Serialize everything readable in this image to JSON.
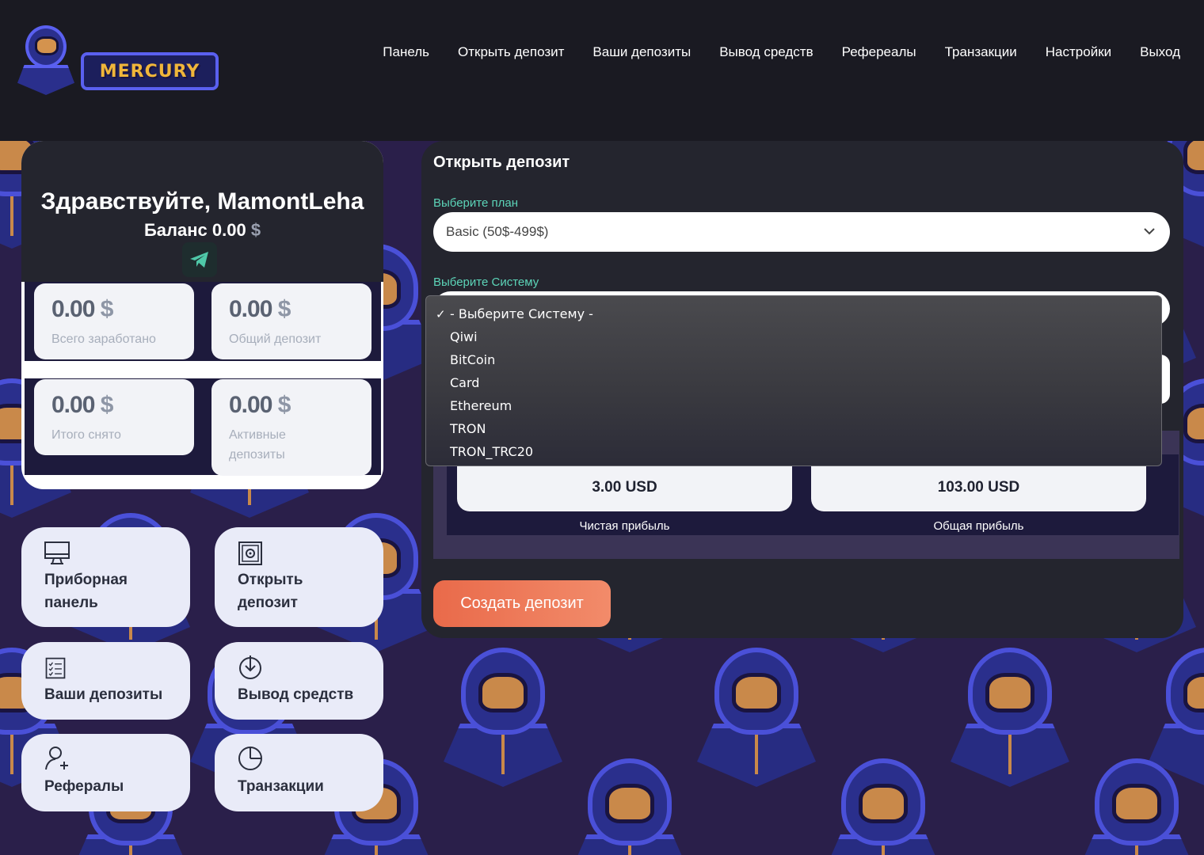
{
  "brand": {
    "name": "MERCURY"
  },
  "nav": [
    "Панель",
    "Открыть депозит",
    "Ваши депозиты",
    "Вывод средств",
    "Рефереалы",
    "Транзакции",
    "Настройки",
    "Выход"
  ],
  "user": {
    "greeting": "Здравствуйте, MamontLeha",
    "balance_label": "Баланс",
    "balance_value": "0.00",
    "currency_symbol": "$"
  },
  "stats": [
    {
      "value": "0.00",
      "symbol": "$",
      "label": "Всего заработано"
    },
    {
      "value": "0.00",
      "symbol": "$",
      "label": "Общий депозит"
    },
    {
      "value": "0.00",
      "symbol": "$",
      "label": "Итого снято"
    },
    {
      "value": "0.00",
      "symbol": "$",
      "label": "Активные депозиты"
    }
  ],
  "tiles": [
    {
      "label": "Приборная панель",
      "icon": "monitor-icon"
    },
    {
      "label": "Открыть депозит",
      "icon": "safe-icon"
    },
    {
      "label": "Ваши депозиты",
      "icon": "checklist-icon"
    },
    {
      "label": "Вывод средств",
      "icon": "download-circle-icon"
    },
    {
      "label": "Рефералы",
      "icon": "user-add-icon"
    },
    {
      "label": "Транзакции",
      "icon": "clock-icon"
    }
  ],
  "deposit": {
    "title": "Открыть депозит",
    "plan_label": "Выберите план",
    "plan_value": "Basic (50$-499$)",
    "system_label": "Выберите Систему",
    "system_options": [
      "- Выберите Систему -",
      "Qiwi",
      "BitCoin",
      "Card",
      "Ethereum",
      "TRON",
      "TRON_TRC20"
    ],
    "selected_system": "- Выберите Систему -",
    "net_profit_value": "3.00 USD",
    "net_profit_label": "Чистая прибыль",
    "total_profit_value": "103.00 USD",
    "total_profit_label": "Общая прибыль",
    "create_button": "Создать депозит"
  },
  "colors": {
    "accent": "#5cd4b8",
    "button": "#ec7553",
    "panel": "#24252e",
    "header": "#1a1a22"
  }
}
